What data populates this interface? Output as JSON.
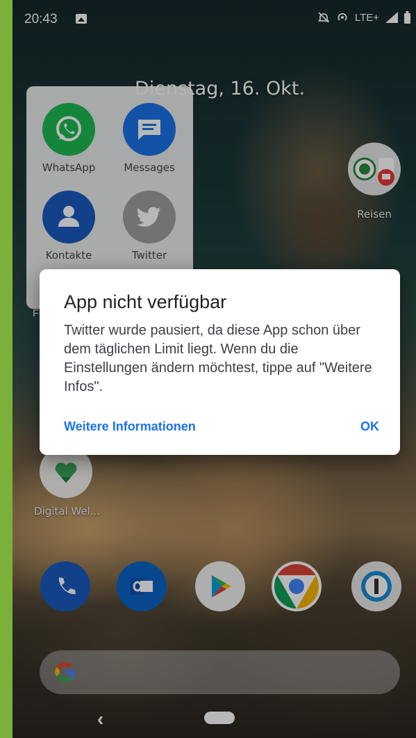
{
  "status_bar": {
    "time": "20:43",
    "network": "LTE+",
    "icons": [
      "image-icon",
      "alarm-off-icon",
      "hotspot-icon",
      "signal-icon",
      "battery-icon"
    ]
  },
  "home": {
    "date": "Dienstag, 16. Okt.",
    "folder": {
      "apps": [
        {
          "label": "WhatsApp",
          "icon": "whatsapp-icon",
          "color": "#1eb954"
        },
        {
          "label": "Messages",
          "icon": "messages-icon",
          "color": "#1a73e8"
        },
        {
          "label": "Kontakte",
          "icon": "contacts-icon",
          "color": "#1a5bbf"
        },
        {
          "label": "Twitter",
          "icon": "twitter-icon",
          "color": "#9e9e9e"
        }
      ],
      "name_partial": "F"
    },
    "reisen": {
      "label": "Reisen"
    },
    "digital_wellbeing": {
      "label": "Digital Wel..."
    },
    "dock": [
      {
        "name": "phone-icon",
        "color": "#1a5bbf"
      },
      {
        "name": "outlook-icon",
        "color": "#0a63c7"
      },
      {
        "name": "play-store-icon",
        "color": "#f2f2f2"
      },
      {
        "name": "chrome-icon",
        "color": "#ffffff"
      },
      {
        "name": "onepassword-icon",
        "color": "#e8e8e8"
      }
    ]
  },
  "dialog": {
    "title": "App nicht verfügbar",
    "body": "Twitter wurde pausiert, da diese App schon über dem täglichen Limit liegt. Wenn du die Einstellungen ändern möchtest, tippe auf \"Weitere Infos\".",
    "more_label": "Weitere Informationen",
    "ok_label": "OK"
  },
  "nav": {
    "back_glyph": "‹"
  },
  "colors": {
    "accent": "#1a73e8"
  }
}
